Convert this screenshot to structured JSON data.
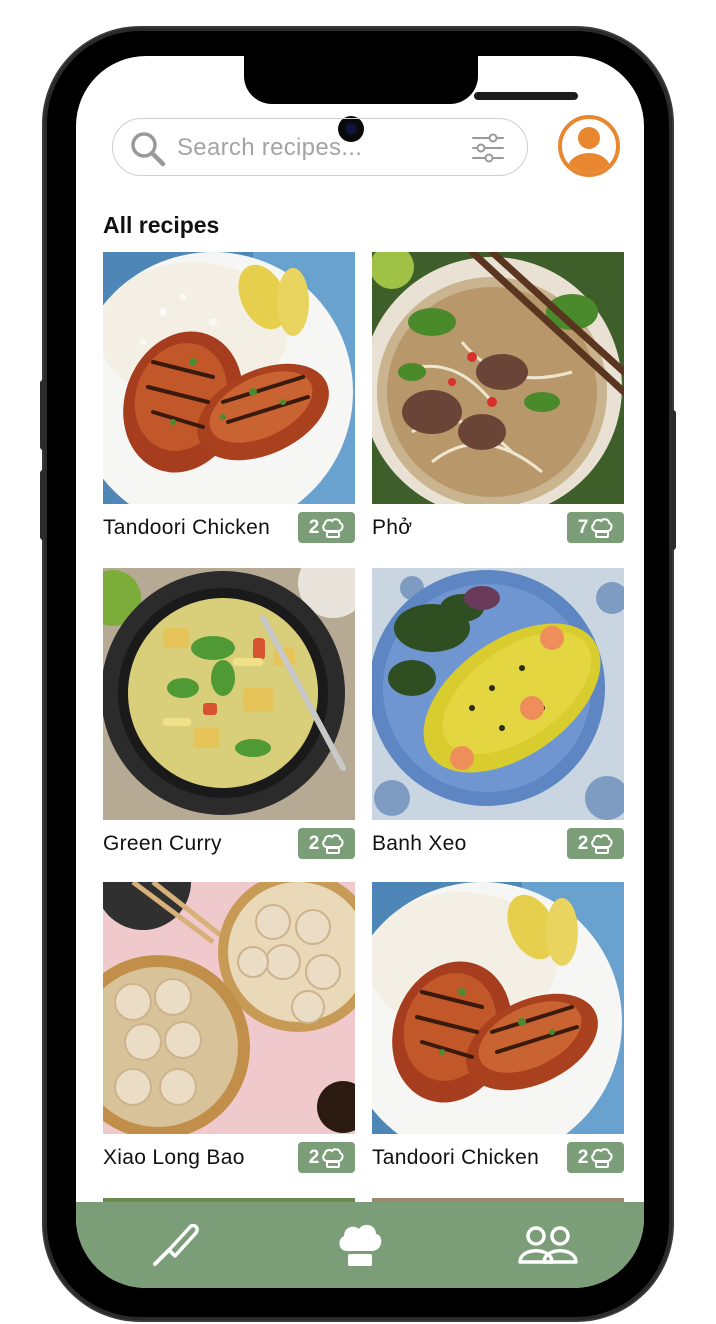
{
  "search": {
    "placeholder": "Search recipes..."
  },
  "section_title": "All recipes",
  "recipes": [
    {
      "name": "Tandoori Chicken",
      "servings": "2"
    },
    {
      "name": "Phở",
      "servings": "7"
    },
    {
      "name": "Green Curry",
      "servings": "2"
    },
    {
      "name": "Banh Xeo",
      "servings": "2"
    },
    {
      "name": "Xiao Long Bao",
      "servings": "2"
    },
    {
      "name": "Tandoori Chicken",
      "servings": "2"
    }
  ],
  "colors": {
    "accent_green": "#7b9e78",
    "avatar_orange": "#e8872f"
  },
  "icons": {
    "search": "search-icon",
    "filter": "filter-sliders-icon",
    "profile": "user-avatar-icon",
    "badge": "chef-hat-icon",
    "nav": [
      "knife-icon",
      "chef-hat-icon",
      "users-icon"
    ]
  }
}
